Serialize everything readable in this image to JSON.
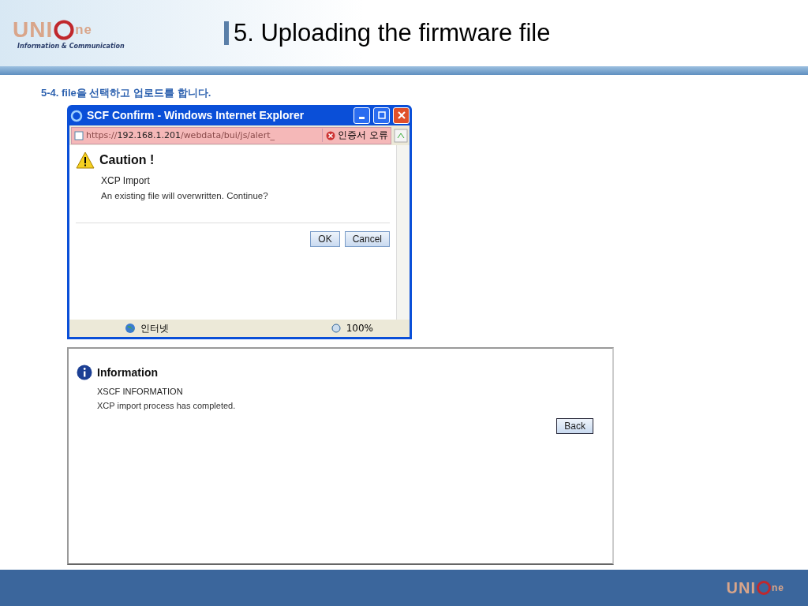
{
  "header": {
    "logo": {
      "mark_left": "UNI",
      "mark_right": "ne",
      "tagline": "Information & Communication"
    },
    "title": "5. Uploading the firmware file"
  },
  "step": "5-4. file을 선택하고 업로드를 합니다.",
  "popup": {
    "title": "SCF Confirm - Windows Internet Explorer",
    "address": "https://**192.168.1.201**/webdata/bui/js/alert_",
    "cert_error": "인증서 오류",
    "dialog": {
      "heading": "Caution !",
      "subtitle": "XCP Import",
      "message": "An existing file will overwritten. Continue?",
      "buttons": [
        "OK",
        "Cancel"
      ]
    },
    "status_bar": {
      "zone": "인터넷",
      "zoom": "100%"
    }
  },
  "info_panel": {
    "heading": "Information",
    "subtitle": "XSCF INFORMATION",
    "message": "XCP import process has completed.",
    "button": "Back"
  },
  "footer": {
    "logo": {
      "mark_left": "UNI",
      "mark_right": "ne"
    }
  }
}
